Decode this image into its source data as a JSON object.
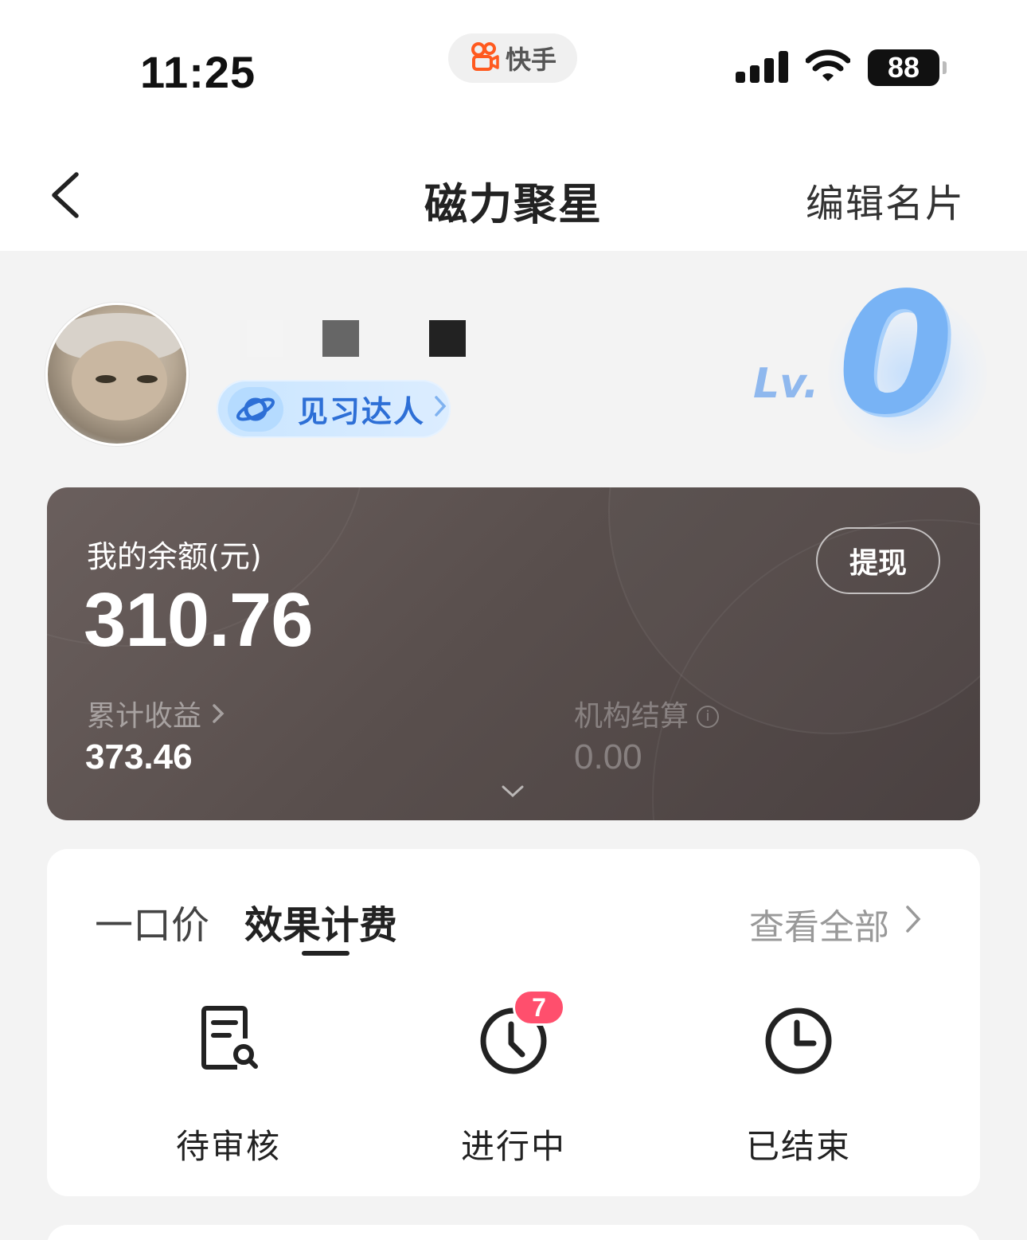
{
  "status_bar": {
    "time": "11:25",
    "app_label": "快手",
    "battery": "88",
    "icons": [
      "signal-icon",
      "wifi-icon",
      "battery-icon"
    ]
  },
  "navbar": {
    "title": "磁力聚星",
    "edit_label": "编辑名片"
  },
  "profile": {
    "badge_label": "见习达人",
    "level_prefix": "Lv.",
    "level_value": "0"
  },
  "balance": {
    "label": "我的余额(元)",
    "amount": "310.76",
    "withdraw_label": "提现",
    "cumulative_label": "累计收益",
    "cumulative_value": "373.46",
    "org_label": "机构结算",
    "org_value": "0.00"
  },
  "orders": {
    "tabs": [
      {
        "label": "一口价",
        "active": false
      },
      {
        "label": "效果计费",
        "active": true
      }
    ],
    "see_all_label": "查看全部",
    "items": [
      {
        "label": "待审核",
        "icon": "review-document-icon"
      },
      {
        "label": "进行中",
        "icon": "clock-icon",
        "badge": "7"
      },
      {
        "label": "已结束",
        "icon": "clock-icon"
      }
    ]
  },
  "colors": {
    "card_dark": "#594f4d",
    "badge_blue": "#2d6fd6",
    "level_blue": "#78b3f5",
    "count_badge": "#ff4f6d",
    "brand_orange": "#ff5a1f"
  }
}
